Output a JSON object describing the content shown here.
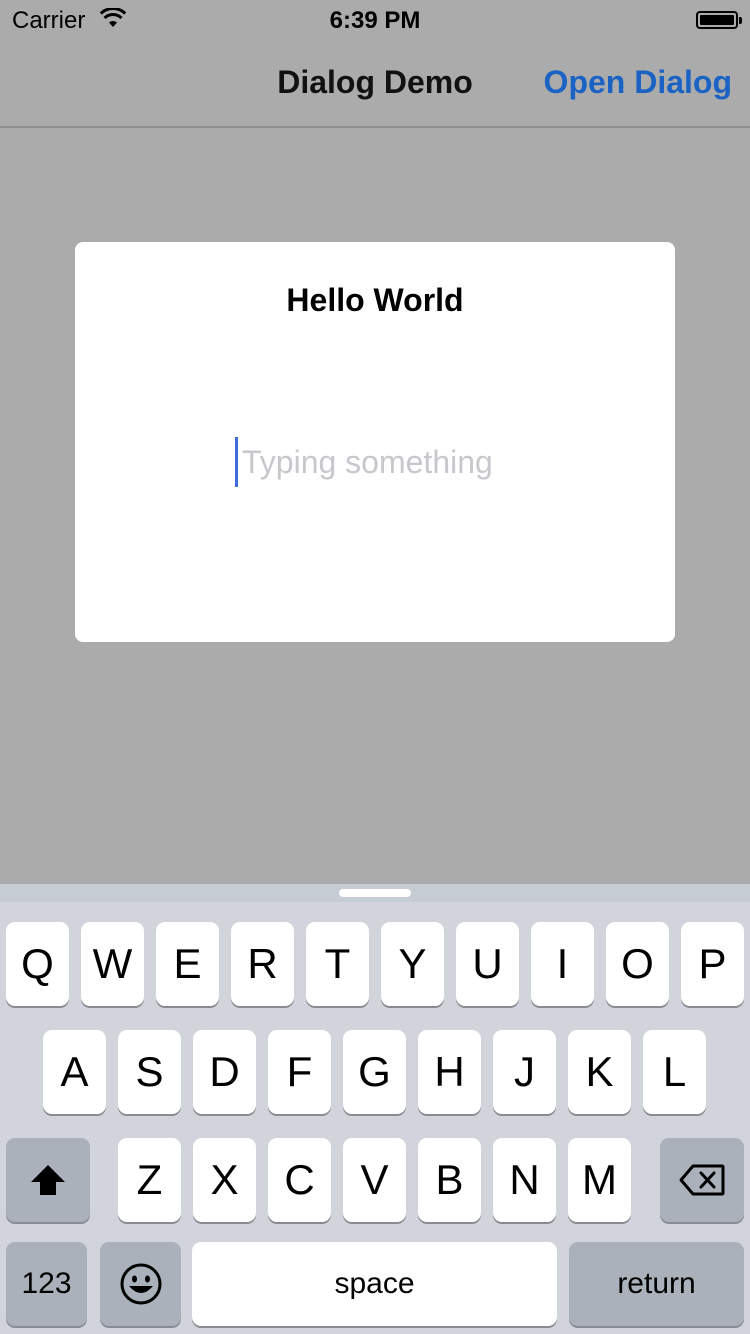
{
  "status_bar": {
    "carrier": "Carrier",
    "time": "6:39 PM"
  },
  "nav_bar": {
    "title": "Dialog Demo",
    "action_label": "Open Dialog"
  },
  "dialog": {
    "title": "Hello World",
    "input_placeholder": "Typing something",
    "input_value": ""
  },
  "keyboard": {
    "row1": [
      "Q",
      "W",
      "E",
      "R",
      "T",
      "Y",
      "U",
      "I",
      "O",
      "P"
    ],
    "row2": [
      "A",
      "S",
      "D",
      "F",
      "G",
      "H",
      "J",
      "K",
      "L"
    ],
    "row3": [
      "Z",
      "X",
      "C",
      "V",
      "B",
      "N",
      "M"
    ],
    "shift_icon": "shift-icon",
    "delete_icon": "delete-icon",
    "numbers_label": "123",
    "emoji_icon": "emoji-icon",
    "space_label": "space",
    "return_label": "return"
  },
  "colors": {
    "accent": "#1a63c4",
    "background": "#ababab",
    "keyboard_bg": "#d1d5db",
    "cursor": "#3c6ce0"
  }
}
